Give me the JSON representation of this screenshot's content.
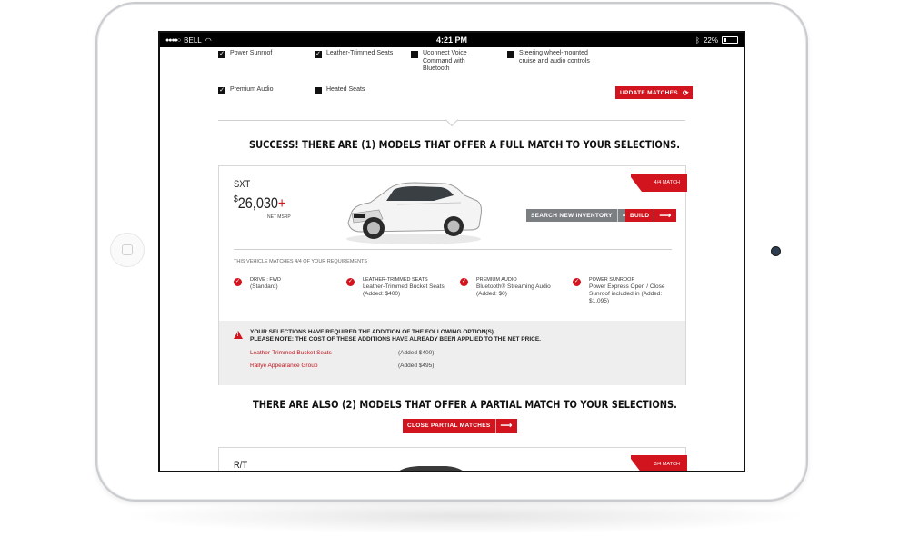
{
  "status_bar": {
    "carrier": "BELL",
    "time": "4:21 PM",
    "battery": "22%"
  },
  "options": [
    {
      "label": "Power Sunroof",
      "checked": true
    },
    {
      "label": "Leather-Trimmed Seats",
      "checked": true
    },
    {
      "label": "Uconnect Voice Command with Bluetooth",
      "checked": false
    },
    {
      "label": "Steering wheel-mounted cruise and audio controls",
      "checked": false
    },
    {
      "label": "Premium Audio",
      "checked": true
    },
    {
      "label": "Heated Seats",
      "checked": false
    }
  ],
  "update_button": "UPDATE MATCHES",
  "full_match_headline": "SUCCESS! THERE ARE (1) MODELS THAT OFFER A FULL MATCH TO YOUR SELECTIONS.",
  "card1": {
    "trim": "SXT",
    "price_symbol": "$",
    "price": "26,030",
    "price_plus": "+",
    "price_note": "NET MSRP",
    "ribbon": "4/4 MATCH",
    "search_button": "SEARCH NEW INVENTORY",
    "build_button": "BUILD",
    "matches_heading": "THIS VEHICLE MATCHES 4/4 OF YOUR REQUIREMENTS",
    "features": [
      {
        "title": "DRIVE : FWD",
        "detail": "(Standard)"
      },
      {
        "title": "LEATHER-TRIMMED SEATS",
        "detail": "Leather-Trimmed Bucket Seats (Added: $400)"
      },
      {
        "title": "PREMIUM AUDIO",
        "detail": "Bluetooth® Streaming Audio (Added: $0)"
      },
      {
        "title": "POWER SUNROOF",
        "detail": "Power Express Open / Close Sunroof included in (Added: $1,095)"
      }
    ],
    "notice_line1": "YOUR SELECTIONS HAVE REQUIRED THE ADDITION OF THE FOLLOWING OPTION(S).",
    "notice_line2": "PLEASE NOTE: THE COST OF THESE ADDITIONS HAVE ALREADY BEEN APPLIED TO THE NET PRICE.",
    "addons": [
      {
        "name": "Leather-Trimmed Bucket Seats",
        "price": "(Added $400)"
      },
      {
        "name": "Rallye Appearance Group",
        "price": "(Added $495)"
      }
    ]
  },
  "partial_headline": "THERE ARE ALSO (2) MODELS THAT OFFER A PARTIAL MATCH TO YOUR SELECTIONS.",
  "close_partial_button": "CLOSE PARTIAL MATCHES",
  "card2": {
    "trim": "R/T",
    "ribbon": "3/4 MATCH"
  },
  "colors": {
    "accent": "#d2141e",
    "grey_button": "#7c7f82",
    "notice_bg": "#eeeeee"
  }
}
